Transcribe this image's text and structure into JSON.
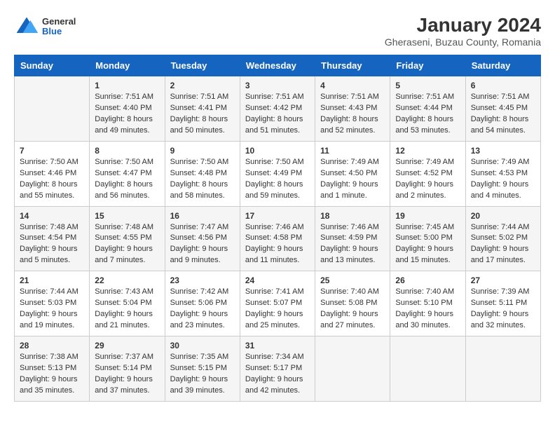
{
  "header": {
    "logo": {
      "general": "General",
      "blue": "Blue"
    },
    "title": "January 2024",
    "subtitle": "Gheraseni, Buzau County, Romania"
  },
  "days_of_week": [
    "Sunday",
    "Monday",
    "Tuesday",
    "Wednesday",
    "Thursday",
    "Friday",
    "Saturday"
  ],
  "weeks": [
    [
      null,
      {
        "num": "1",
        "sunrise": "7:51 AM",
        "sunset": "4:40 PM",
        "daylight": "8 hours and 49 minutes."
      },
      {
        "num": "2",
        "sunrise": "7:51 AM",
        "sunset": "4:41 PM",
        "daylight": "8 hours and 50 minutes."
      },
      {
        "num": "3",
        "sunrise": "7:51 AM",
        "sunset": "4:42 PM",
        "daylight": "8 hours and 51 minutes."
      },
      {
        "num": "4",
        "sunrise": "7:51 AM",
        "sunset": "4:43 PM",
        "daylight": "8 hours and 52 minutes."
      },
      {
        "num": "5",
        "sunrise": "7:51 AM",
        "sunset": "4:44 PM",
        "daylight": "8 hours and 53 minutes."
      },
      {
        "num": "6",
        "sunrise": "7:51 AM",
        "sunset": "4:45 PM",
        "daylight": "8 hours and 54 minutes."
      }
    ],
    [
      {
        "num": "7",
        "sunrise": "7:50 AM",
        "sunset": "4:46 PM",
        "daylight": "8 hours and 55 minutes."
      },
      {
        "num": "8",
        "sunrise": "7:50 AM",
        "sunset": "4:47 PM",
        "daylight": "8 hours and 56 minutes."
      },
      {
        "num": "9",
        "sunrise": "7:50 AM",
        "sunset": "4:48 PM",
        "daylight": "8 hours and 58 minutes."
      },
      {
        "num": "10",
        "sunrise": "7:50 AM",
        "sunset": "4:49 PM",
        "daylight": "8 hours and 59 minutes."
      },
      {
        "num": "11",
        "sunrise": "7:49 AM",
        "sunset": "4:50 PM",
        "daylight": "9 hours and 1 minute."
      },
      {
        "num": "12",
        "sunrise": "7:49 AM",
        "sunset": "4:52 PM",
        "daylight": "9 hours and 2 minutes."
      },
      {
        "num": "13",
        "sunrise": "7:49 AM",
        "sunset": "4:53 PM",
        "daylight": "9 hours and 4 minutes."
      }
    ],
    [
      {
        "num": "14",
        "sunrise": "7:48 AM",
        "sunset": "4:54 PM",
        "daylight": "9 hours and 5 minutes."
      },
      {
        "num": "15",
        "sunrise": "7:48 AM",
        "sunset": "4:55 PM",
        "daylight": "9 hours and 7 minutes."
      },
      {
        "num": "16",
        "sunrise": "7:47 AM",
        "sunset": "4:56 PM",
        "daylight": "9 hours and 9 minutes."
      },
      {
        "num": "17",
        "sunrise": "7:46 AM",
        "sunset": "4:58 PM",
        "daylight": "9 hours and 11 minutes."
      },
      {
        "num": "18",
        "sunrise": "7:46 AM",
        "sunset": "4:59 PM",
        "daylight": "9 hours and 13 minutes."
      },
      {
        "num": "19",
        "sunrise": "7:45 AM",
        "sunset": "5:00 PM",
        "daylight": "9 hours and 15 minutes."
      },
      {
        "num": "20",
        "sunrise": "7:44 AM",
        "sunset": "5:02 PM",
        "daylight": "9 hours and 17 minutes."
      }
    ],
    [
      {
        "num": "21",
        "sunrise": "7:44 AM",
        "sunset": "5:03 PM",
        "daylight": "9 hours and 19 minutes."
      },
      {
        "num": "22",
        "sunrise": "7:43 AM",
        "sunset": "5:04 PM",
        "daylight": "9 hours and 21 minutes."
      },
      {
        "num": "23",
        "sunrise": "7:42 AM",
        "sunset": "5:06 PM",
        "daylight": "9 hours and 23 minutes."
      },
      {
        "num": "24",
        "sunrise": "7:41 AM",
        "sunset": "5:07 PM",
        "daylight": "9 hours and 25 minutes."
      },
      {
        "num": "25",
        "sunrise": "7:40 AM",
        "sunset": "5:08 PM",
        "daylight": "9 hours and 27 minutes."
      },
      {
        "num": "26",
        "sunrise": "7:40 AM",
        "sunset": "5:10 PM",
        "daylight": "9 hours and 30 minutes."
      },
      {
        "num": "27",
        "sunrise": "7:39 AM",
        "sunset": "5:11 PM",
        "daylight": "9 hours and 32 minutes."
      }
    ],
    [
      {
        "num": "28",
        "sunrise": "7:38 AM",
        "sunset": "5:13 PM",
        "daylight": "9 hours and 35 minutes."
      },
      {
        "num": "29",
        "sunrise": "7:37 AM",
        "sunset": "5:14 PM",
        "daylight": "9 hours and 37 minutes."
      },
      {
        "num": "30",
        "sunrise": "7:35 AM",
        "sunset": "5:15 PM",
        "daylight": "9 hours and 39 minutes."
      },
      {
        "num": "31",
        "sunrise": "7:34 AM",
        "sunset": "5:17 PM",
        "daylight": "9 hours and 42 minutes."
      },
      null,
      null,
      null
    ]
  ],
  "labels": {
    "sunrise": "Sunrise:",
    "sunset": "Sunset:",
    "daylight": "Daylight:"
  }
}
